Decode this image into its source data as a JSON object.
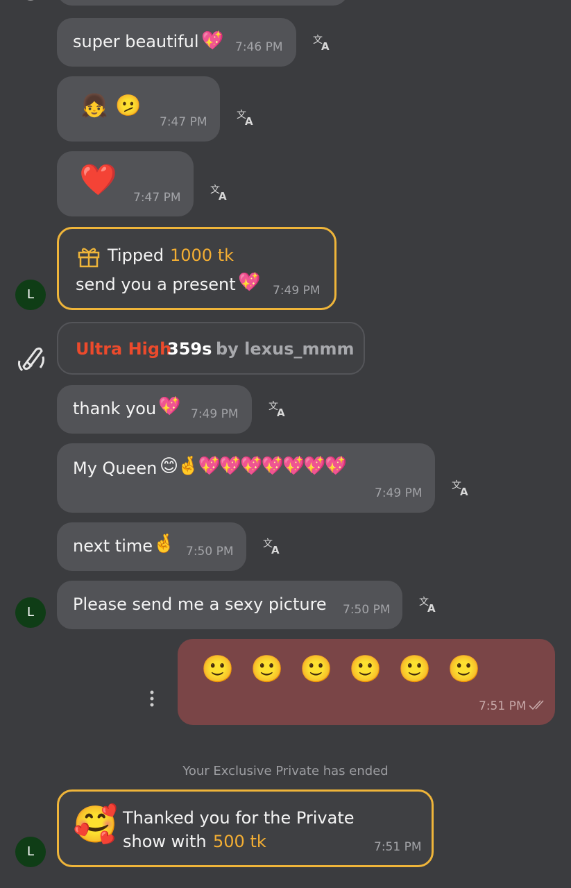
{
  "messages": {
    "m1": {
      "text": "super beautiful",
      "emoji": "💖",
      "time": "7:46 PM"
    },
    "m2": {
      "emoji1": "👧",
      "emoji2": "🫤",
      "time": "7:47 PM"
    },
    "m3": {
      "emoji": "❤️",
      "time": "7:47 PM"
    },
    "tip": {
      "label": "Tipped",
      "amount": "1000 tk",
      "message": "send you a present",
      "emoji": "💖",
      "time": "7:49 PM"
    },
    "ultra": {
      "level": "Ultra High",
      "duration": "359s",
      "by": "by lexus_mmm"
    },
    "m4": {
      "text": "thank you",
      "emoji": "💖",
      "time": "7:49 PM"
    },
    "m5": {
      "text": "My Queen",
      "emoji": "😊🤞💖💖💖💖💖💖💖",
      "time": "7:49 PM"
    },
    "m6": {
      "text": "next time",
      "emoji": "🤞",
      "time": "7:50 PM"
    },
    "m7": {
      "text": "Please send me a sexy picture",
      "time": "7:50 PM"
    },
    "outgoing": {
      "emojis": [
        "🙂",
        "🙂",
        "🙂",
        "🙂",
        "🙂",
        "🙂"
      ],
      "time": "7:51 PM"
    },
    "system": "Your Exclusive Private has ended",
    "thanks": {
      "line1": "Thanked you for the Private",
      "line2_prefix": "show with",
      "amount": "500 tk",
      "emoji": "🥰",
      "time": "7:51 PM"
    }
  },
  "avatar_letter": "L",
  "colors": {
    "accent_gold": "#f3ae33",
    "ultra_red": "#ec4a2c",
    "outgoing_bg": "#7a4547",
    "avatar_bg": "#0f3d16"
  }
}
